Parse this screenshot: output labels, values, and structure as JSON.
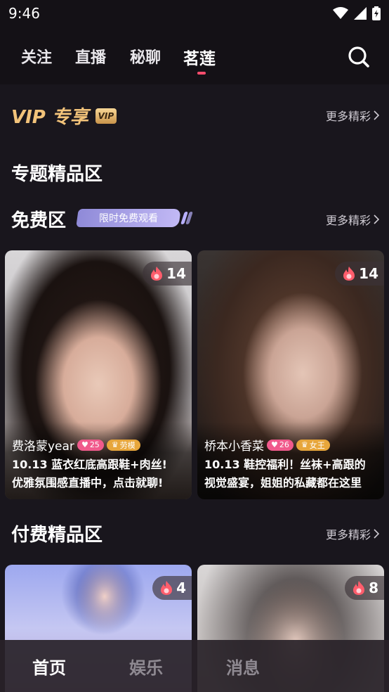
{
  "status_bar": {
    "time": "9:46"
  },
  "top_tabs": [
    {
      "label": "关注"
    },
    {
      "label": "直播"
    },
    {
      "label": "秘聊"
    },
    {
      "label": "茗莲"
    }
  ],
  "vip": {
    "title": "VIP 专享",
    "badge": "VIP",
    "more": "更多精彩"
  },
  "topic": {
    "title": "专题精品区"
  },
  "free_section": {
    "title": "免费区",
    "badge": "限时免费观看",
    "more": "更多精彩",
    "cards": [
      {
        "fire": "14",
        "name": "费洛蒙year",
        "level": "25",
        "role": "劳模",
        "desc_line1": "10.13 蓝衣红底高跟鞋+肉丝!",
        "desc_line2": "优雅氛围感直播中，点击就聊!"
      },
      {
        "fire": "14",
        "name": "桥本小香菜",
        "level": "26",
        "role": "女王",
        "desc_line1": "10.13 鞋控福利！丝袜+高跟的",
        "desc_line2": "视觉盛宴，姐姐的私藏都在这里"
      }
    ]
  },
  "paid_section": {
    "title": "付费精品区",
    "more": "更多精彩",
    "cards": [
      {
        "fire": "4"
      },
      {
        "fire": "8"
      }
    ]
  },
  "bottom_nav": [
    {
      "label": "首页"
    },
    {
      "label": "娱乐"
    },
    {
      "label": "消息"
    }
  ],
  "colors": {
    "background": "#19161d",
    "vip_gold": "#f2c37a",
    "indicator": "#ff4d6d",
    "level_pink": "#f05a8c",
    "role_gold": "#e7a63b"
  }
}
